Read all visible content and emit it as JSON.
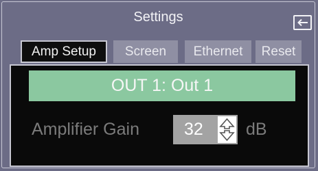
{
  "header": {
    "title": "Settings",
    "back_icon": "arrow-left-icon"
  },
  "tabs": [
    {
      "label": "Amp Setup",
      "active": true
    },
    {
      "label": "Screen",
      "active": false
    },
    {
      "label": "Ethernet",
      "active": false
    },
    {
      "label": "Reset",
      "active": false
    }
  ],
  "output": {
    "label": "OUT 1: Out 1"
  },
  "gain": {
    "label": "Amplifier Gain",
    "value": "32",
    "unit": "dB",
    "stepper_icon": "up-down-arrows-icon"
  },
  "colors": {
    "background": "#6c6c86",
    "panel": "#0a0a0a",
    "banner": "#8bc8a0",
    "tab_inactive": "#8f8fa3",
    "value_box": "#a3a3a3",
    "dim_text": "#7b7b7b"
  }
}
